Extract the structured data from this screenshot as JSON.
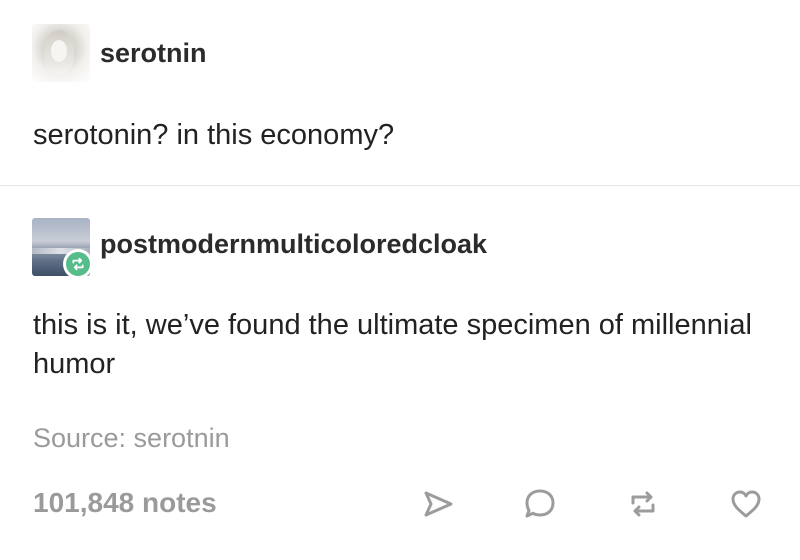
{
  "original_post": {
    "username": "serotnin",
    "text": "serotonin? in this economy?",
    "avatar_icon": "user-avatar"
  },
  "reblog": {
    "username": "postmodernmulticoloredcloak",
    "text": "this is it, we’ve found the ultimate specimen of millennial humor",
    "avatar_icon": "user-avatar",
    "badge_icon": "reblog-icon",
    "badge_color": "#56bc8a"
  },
  "footer": {
    "source": "Source: serotnin",
    "notes": "101,848 notes",
    "actions": [
      {
        "name": "share",
        "icon": "paper-plane-icon"
      },
      {
        "name": "reply",
        "icon": "speech-bubble-icon"
      },
      {
        "name": "reblog",
        "icon": "reblog-icon"
      },
      {
        "name": "like",
        "icon": "heart-icon"
      }
    ]
  },
  "colors": {
    "text": "#222222",
    "muted": "#9a9a9a",
    "icon": "#a0a0a0",
    "divider": "#e6e6e6"
  }
}
